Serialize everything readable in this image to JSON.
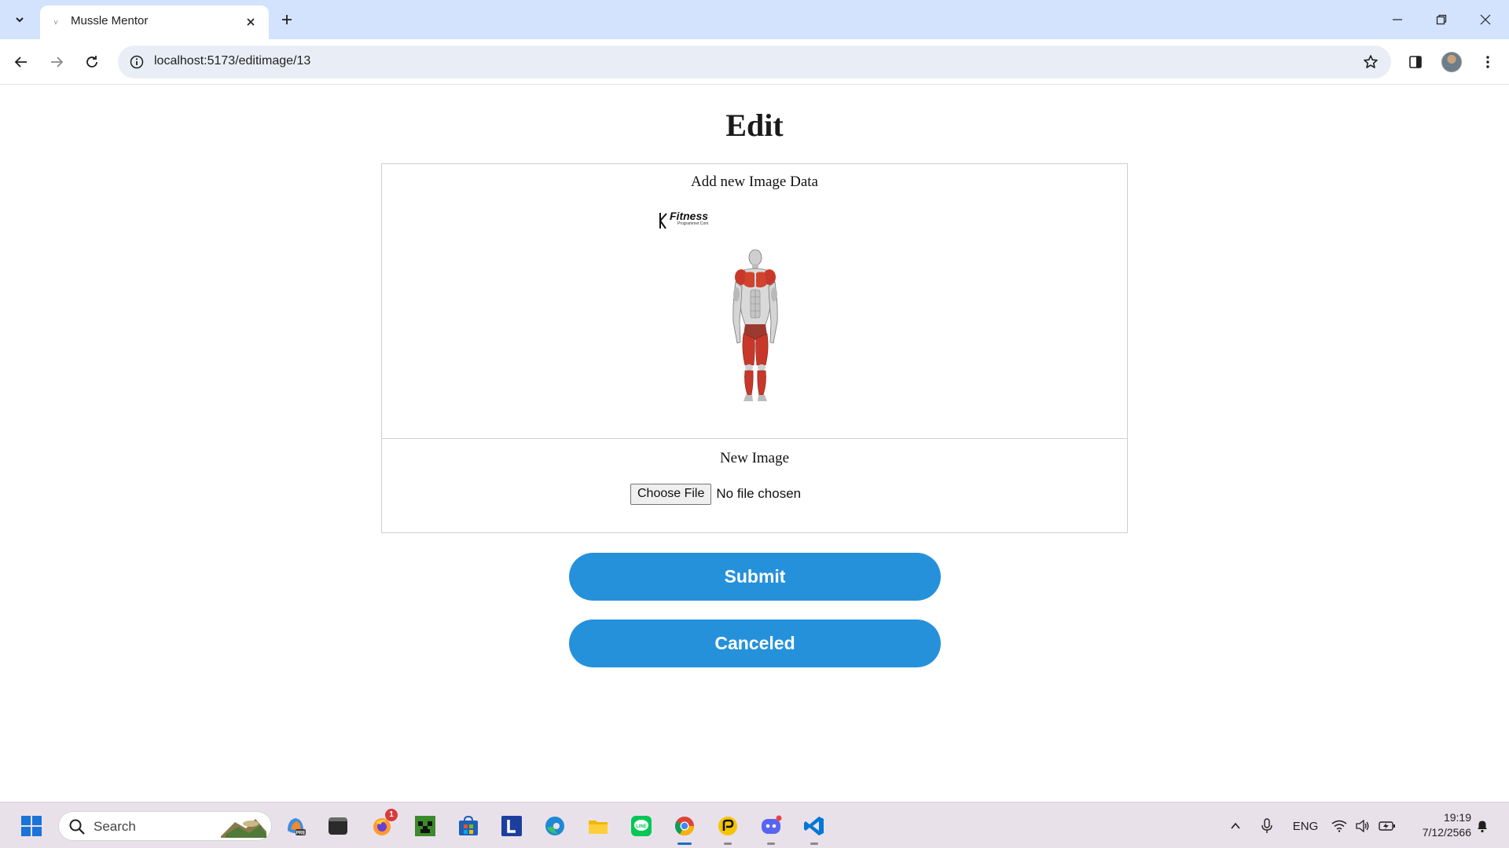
{
  "browser": {
    "tab_title": "Mussle Mentor",
    "tab_favicon": "v",
    "url": "localhost:5173/editimage/13"
  },
  "page": {
    "title": "Edit",
    "image_section_label": "Add new Image Data",
    "current_image": {
      "logo_text": "Fitness",
      "logo_subtext": "Programmer.Com",
      "alt": "muscle-diagram-image"
    },
    "new_image_label": "New Image",
    "file_button_label": "Choose File",
    "file_status": "No file chosen",
    "submit_label": "Submit",
    "cancel_label": "Canceled",
    "accent_color": "#2591db"
  },
  "taskbar": {
    "search_placeholder": "Search",
    "notification_badge": "1",
    "language": "ENG",
    "time": "19:19",
    "date": "7/12/2566",
    "apps": [
      "copilot-icon",
      "file-explorer-dark-icon",
      "firefox-icon",
      "minecraft-icon",
      "microsoft-store-icon",
      "letterboxd-l-icon",
      "edge-icon",
      "folder-icon",
      "line-icon",
      "chrome-icon",
      "podcast-app-icon",
      "discord-icon",
      "vscode-icon"
    ]
  }
}
